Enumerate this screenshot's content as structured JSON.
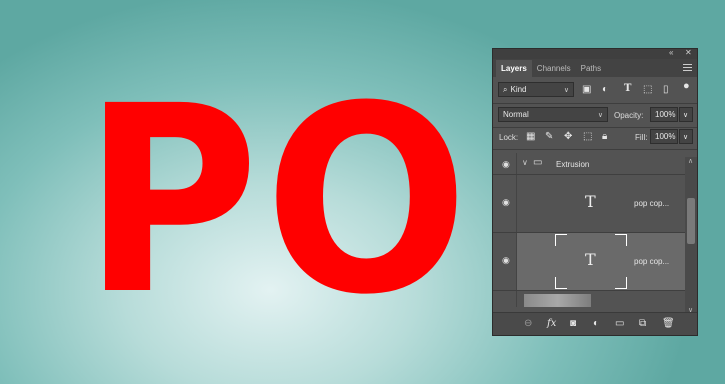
{
  "canvas": {
    "text": "POP",
    "text_color": "#ff0000"
  },
  "panel": {
    "collapse_icon": "«",
    "close_icon": "✕",
    "tabs": [
      {
        "label": "Layers",
        "active": true
      },
      {
        "label": "Channels",
        "active": false
      },
      {
        "label": "Paths",
        "active": false
      }
    ],
    "filter": {
      "kind_label": "Kind"
    },
    "blend_mode": "Normal",
    "opacity_label": "Opacity:",
    "opacity_value": "100%",
    "lock_label": "Lock:",
    "fill_label": "Fill:",
    "fill_value": "100%",
    "layers": [
      {
        "name": "Extrusion",
        "type": "group"
      },
      {
        "name": "pop cop...",
        "type": "text"
      },
      {
        "name": "pop cop...",
        "type": "text",
        "selected": true
      }
    ],
    "bottom_icons": [
      "link-icon",
      "fx-icon",
      "mask-icon",
      "adjustment-icon",
      "folder-icon",
      "new-layer-icon",
      "trash-icon"
    ],
    "fx_label": "fx"
  }
}
